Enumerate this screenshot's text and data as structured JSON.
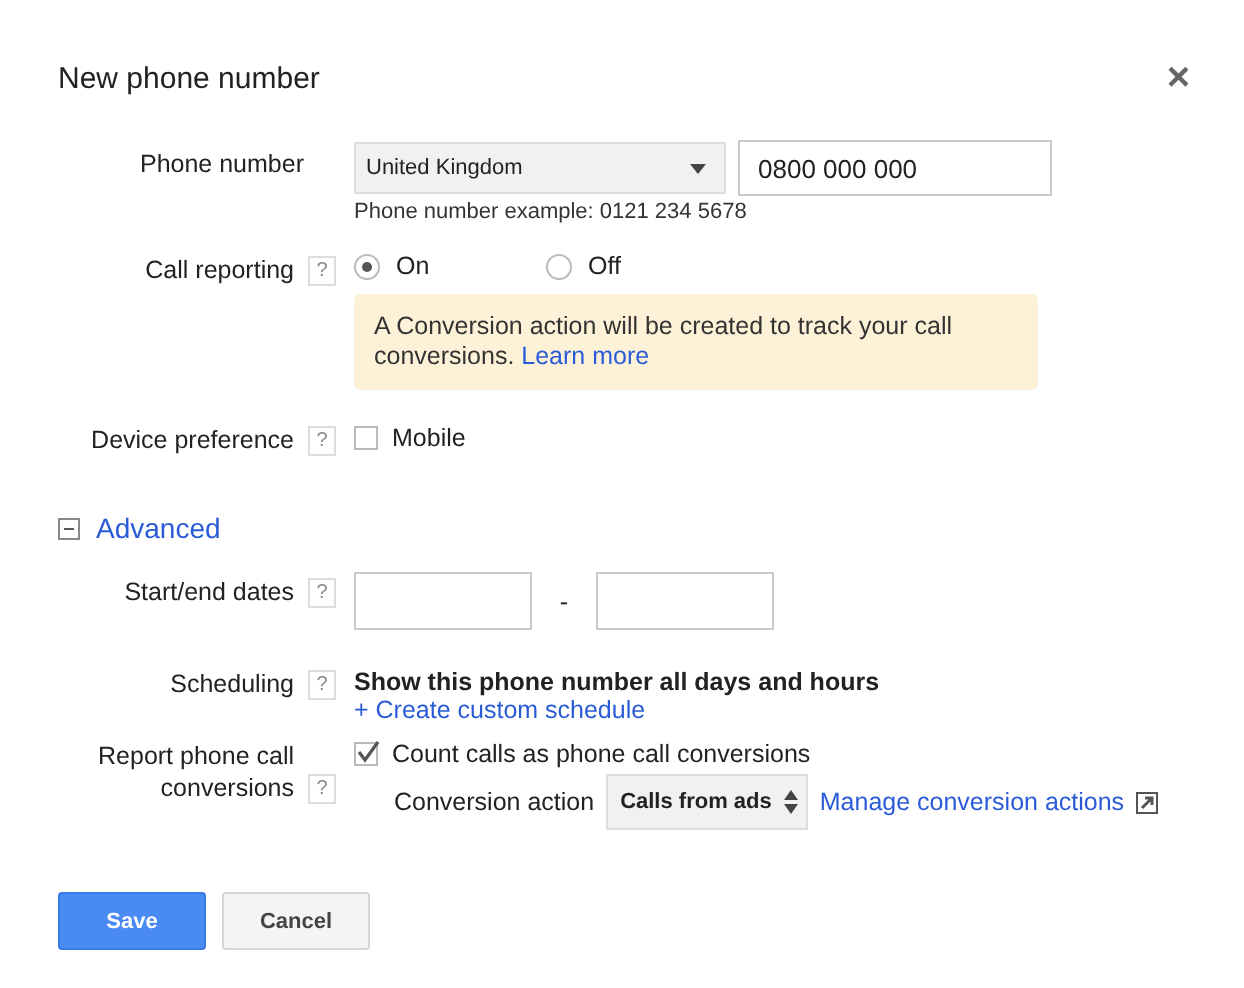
{
  "dialog": {
    "title": "New phone number",
    "close": "×"
  },
  "phone": {
    "label": "Phone number",
    "country": "United Kingdom",
    "value": "0800 000 000",
    "hint": "Phone number example: 0121 234 5678"
  },
  "call_reporting": {
    "label": "Call reporting",
    "help": "?",
    "options": [
      {
        "label": "On",
        "selected": true
      },
      {
        "label": "Off",
        "selected": false
      }
    ],
    "notice": "A Conversion action will be created to track your call conversions.",
    "notice_link": "Learn more"
  },
  "device_preference": {
    "label": "Device preference",
    "help": "?",
    "option": {
      "label": "Mobile",
      "checked": false
    }
  },
  "advanced": {
    "label": "Advanced",
    "expanded": true
  },
  "dates": {
    "label": "Start/end dates",
    "help": "?",
    "separator": "-"
  },
  "scheduling": {
    "label": "Scheduling",
    "help": "?",
    "text": "Show this phone number all days and hours",
    "link": "+ Create custom schedule"
  },
  "report": {
    "label": "Report phone call conversions",
    "help": "?",
    "checkbox": {
      "label": "Count calls as phone call conversions",
      "checked": true
    },
    "action_label": "Conversion action",
    "action_value": "Calls from ads",
    "manage_link": "Manage conversion actions"
  },
  "buttons": [
    {
      "label": "Save",
      "kind": "primary"
    },
    {
      "label": "Cancel",
      "kind": "secondary"
    }
  ]
}
